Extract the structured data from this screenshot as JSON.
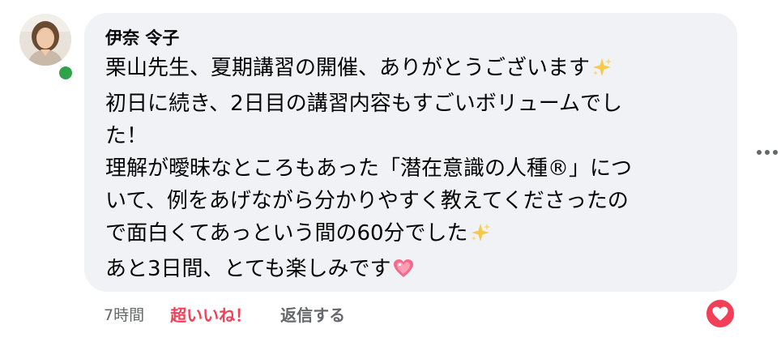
{
  "comment": {
    "author": "伊奈 令子",
    "lines": [
      "栗山先生、夏期講習の開催、ありがとうございます",
      "初日に続き、2日目の講習内容もすごいボリュームでし",
      "た！",
      "理解が曖昧なところもあった「潜在意識の人種®」につ",
      "いて、例をあげながら分かりやすく教えてくださったの",
      "で面白くてあっという間の60分でした",
      "あと3日間、とても楽しみです"
    ],
    "emojis": [
      "sparkles-emoji",
      "sparkles-emoji",
      "sparkling-heart-emoji"
    ]
  },
  "actions": {
    "timestamp": "7時間",
    "reaction_label": "超いいね！",
    "reply_label": "返信する"
  },
  "reaction": {
    "icon": "heart-icon",
    "color": "#f33e58"
  },
  "status": {
    "online_color": "#31a24c"
  }
}
